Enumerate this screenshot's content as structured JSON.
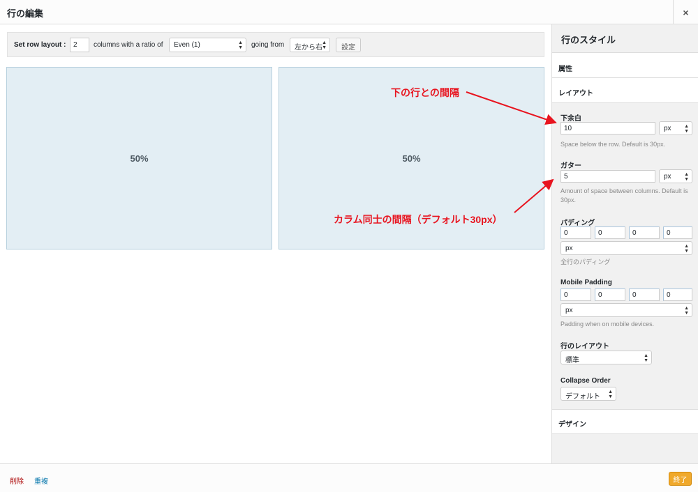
{
  "header": {
    "title": "行の編集",
    "close": "×"
  },
  "toolbar": {
    "set_layout_label": "Set row layout :",
    "columns_value": "2",
    "columns_label": "columns with a ratio of",
    "ratio_value": "Even (1)",
    "going_label": "going from",
    "direction_value": "左から右",
    "set_button": "設定"
  },
  "cells": [
    {
      "label": "50%"
    },
    {
      "label": "50%"
    }
  ],
  "sidebar": {
    "title": "行のスタイル",
    "sections": {
      "attributes": "属性",
      "layout": "レイアウト",
      "design": "デザイン"
    },
    "bottom_margin": {
      "label": "下余白",
      "value": "10",
      "unit": "px",
      "desc": "Space below the row. Default is 30px."
    },
    "gutter": {
      "label": "ガター",
      "value": "5",
      "unit": "px",
      "desc": "Amount of space between columns. Default is 30px."
    },
    "padding": {
      "label": "パディング",
      "values": [
        "0",
        "0",
        "0",
        "0"
      ],
      "unit": "px",
      "desc": "全行のパディング"
    },
    "mobile_padding": {
      "label": "Mobile Padding",
      "values": [
        "0",
        "0",
        "0",
        "0"
      ],
      "unit": "px",
      "desc": "Padding when on mobile devices."
    },
    "row_layout": {
      "label": "行のレイアウト",
      "value": "標準"
    },
    "collapse_order": {
      "label": "Collapse Order",
      "value": "デフォルト"
    }
  },
  "annotations": {
    "bottom_margin_note": "下の行との間隔",
    "gutter_note": "カラム同士の間隔（デフォルト30px）"
  },
  "footer": {
    "delete": "削除",
    "duplicate": "重複",
    "done": "終了"
  },
  "colors": {
    "annotation": "#e8141f",
    "done_button": "#f0a92c",
    "cell_bg": "#e3eef4"
  }
}
